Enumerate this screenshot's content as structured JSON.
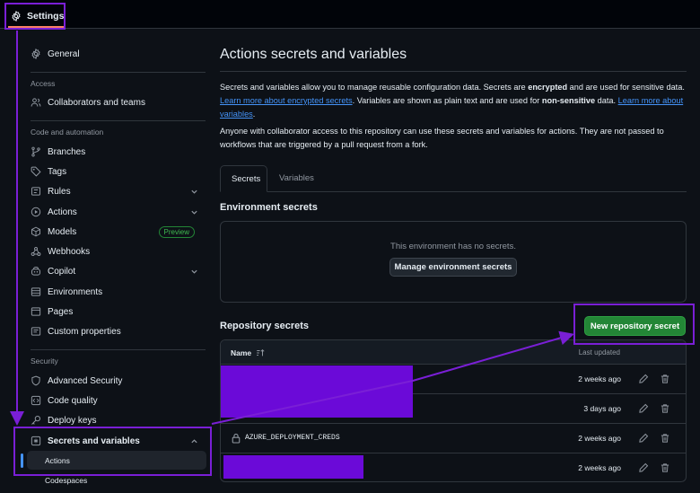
{
  "topbar": {
    "settings_label": "Settings"
  },
  "sidebar": {
    "general": "General",
    "access_label": "Access",
    "collaborators": "Collaborators and teams",
    "code_automation_label": "Code and automation",
    "branches": "Branches",
    "tags": "Tags",
    "rules": "Rules",
    "actions": "Actions",
    "models": "Models",
    "preview_badge": "Preview",
    "webhooks": "Webhooks",
    "copilot": "Copilot",
    "environments": "Environments",
    "pages": "Pages",
    "custom_properties": "Custom properties",
    "security_label": "Security",
    "advanced_security": "Advanced Security",
    "code_quality": "Code quality",
    "deploy_keys": "Deploy keys",
    "secrets_variables": "Secrets and variables",
    "sub_actions": "Actions",
    "sub_codespaces": "Codespaces"
  },
  "main": {
    "title": "Actions secrets and variables",
    "para1_a": "Secrets and variables allow you to manage reusable configuration data. Secrets are ",
    "para1_b": "encrypted",
    "para1_c": " and are used for sensitive data. ",
    "para1_link1": "Learn more about encrypted secrets",
    "para1_d": ". Variables are shown as plain text and are used for ",
    "para1_e": "non-sensitive",
    "para1_f": " data. ",
    "para1_link2": "Learn more about variables",
    "para1_g": ".",
    "para2": "Anyone with collaborator access to this repository can use these secrets and variables for actions. They are not passed to workflows that are triggered by a pull request from a fork.",
    "tabs": [
      {
        "label": "Secrets"
      },
      {
        "label": "Variables"
      }
    ],
    "env_title": "Environment secrets",
    "env_empty": "This environment has no secrets.",
    "env_button": "Manage environment secrets",
    "repo_title": "Repository secrets",
    "new_button": "New repository secret",
    "table": {
      "col_name": "Name",
      "col_updated": "Last updated",
      "rows": [
        {
          "name": "",
          "updated": "2 weeks ago"
        },
        {
          "name": "",
          "updated": "3 days ago"
        },
        {
          "name": "AZURE_DEPLOYMENT_CREDS",
          "updated": "2 weeks ago"
        },
        {
          "name": "",
          "updated": "2 weeks ago"
        }
      ]
    }
  },
  "colors": {
    "background": "#0d1117",
    "accent_link": "#4493f8",
    "primary_button": "#238636",
    "annotation": "#7a1fd6",
    "redaction": "#6b0ad8"
  }
}
